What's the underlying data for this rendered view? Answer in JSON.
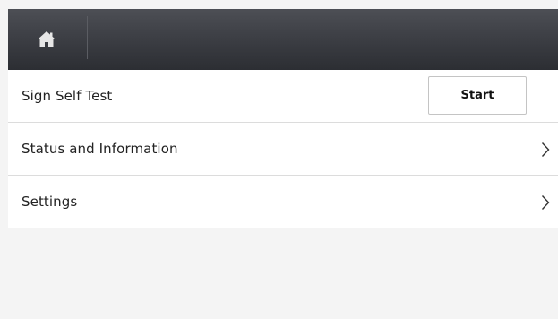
{
  "header": {
    "home_icon": "home-icon"
  },
  "menu": {
    "items": [
      {
        "label": "Sign Self Test",
        "action_label": "Start"
      },
      {
        "label": "Status and Information",
        "icon": "chevron-right-icon"
      },
      {
        "label": "Settings",
        "icon": "chevron-right-icon"
      }
    ]
  },
  "colors": {
    "header_top": "#4d4f55",
    "header_bottom": "#2c2e33",
    "row_background": "#ffffff",
    "page_background": "#f4f4f4",
    "divider": "#dcdcdc"
  }
}
